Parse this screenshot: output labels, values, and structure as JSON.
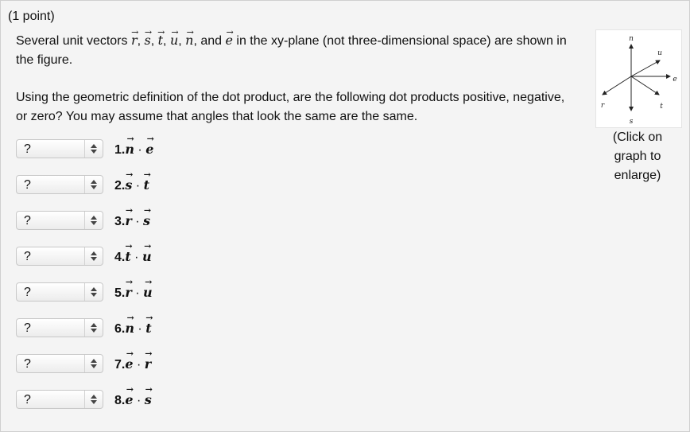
{
  "header": {
    "point_label": "(1 point)"
  },
  "intro": {
    "text_before": "Several unit vectors ",
    "vectors": [
      "r",
      "s",
      "t",
      "u",
      "n"
    ],
    "and": ", and ",
    "last_vector": "e",
    "text_after": " in the xy-plane (not three-dimensional space) are shown in the figure."
  },
  "question": {
    "text": "Using the geometric definition of the dot product, are the following dot products positive, negative, or zero? You may assume that angles that look the same are the same."
  },
  "rows": [
    {
      "number": "1.",
      "a": "n",
      "b": "e",
      "selected": "?"
    },
    {
      "number": "2.",
      "a": "s",
      "b": "t",
      "selected": "?"
    },
    {
      "number": "3.",
      "a": "r",
      "b": "s",
      "selected": "?"
    },
    {
      "number": "4.",
      "a": "t",
      "b": "u",
      "selected": "?"
    },
    {
      "number": "5.",
      "a": "r",
      "b": "u",
      "selected": "?"
    },
    {
      "number": "6.",
      "a": "n",
      "b": "t",
      "selected": "?"
    },
    {
      "number": "7.",
      "a": "e",
      "b": "r",
      "selected": "?"
    },
    {
      "number": "8.",
      "a": "e",
      "b": "s",
      "selected": "?"
    }
  ],
  "figure": {
    "caption": "(Click on graph to enlarge)",
    "vector_labels": {
      "n": "n",
      "u": "u",
      "e": "e",
      "r": "r",
      "t": "t",
      "s": "s"
    }
  }
}
